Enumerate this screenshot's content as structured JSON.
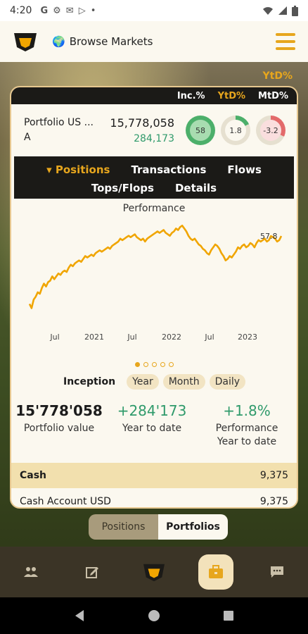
{
  "status_bar": {
    "time": "4:20",
    "icons": [
      "google-icon",
      "gear-icon",
      "gmail-icon",
      "play-icon",
      "dot"
    ],
    "right_icons": [
      "wifi-icon",
      "signal-icon",
      "battery-icon"
    ]
  },
  "app_bar": {
    "browse_label": "Browse Markets",
    "icons": [
      "app-logo",
      "globe-icon",
      "hamburger-menu-icon"
    ]
  },
  "range_indicator": "YtD%",
  "range_tabs": [
    "Inc.%",
    "YtD%",
    "MtD%"
  ],
  "portfolio": {
    "name_line1": "Portfolio US ...",
    "name_line2": "A",
    "value": "15,778,058",
    "change": "284,173",
    "rings": [
      {
        "label": "58",
        "color": "#4caf6a",
        "fill": 0.58
      },
      {
        "label": "1.8",
        "color": "#4caf6a",
        "fill": 0.18
      },
      {
        "label": "-3.2",
        "color": "#e36a6a",
        "fill": 0.32
      }
    ]
  },
  "tabs": {
    "positions": "Positions",
    "transactions": "Transactions",
    "flows": "Flows",
    "tops_flops": "Tops/Flops",
    "details": "Details"
  },
  "chart_data": {
    "type": "line",
    "title": "Performance",
    "x_tick_labels": [
      "Jul",
      "2021",
      "Jul",
      "2022",
      "Jul",
      "2023"
    ],
    "end_label": "57.8",
    "ylim": [
      0,
      70
    ],
    "color": "#f0a500",
    "y": [
      11,
      8,
      14,
      16,
      19,
      18,
      22,
      25,
      23,
      26,
      27,
      30,
      28,
      30,
      32,
      31,
      33,
      34,
      33,
      36,
      38,
      37,
      39,
      40,
      41,
      40,
      42,
      44,
      43,
      44,
      45,
      44,
      46,
      47,
      48,
      47,
      48,
      49,
      50,
      49,
      51,
      52,
      53,
      54,
      56,
      55,
      56,
      57,
      58,
      57,
      58,
      59,
      57,
      56,
      55,
      56,
      54,
      56,
      57,
      58,
      59,
      60,
      61,
      60,
      61,
      62,
      60,
      59,
      58,
      60,
      61,
      63,
      62,
      64,
      65,
      63,
      61,
      58,
      56,
      55,
      56,
      54,
      52,
      51,
      49,
      48,
      46,
      45,
      48,
      50,
      52,
      51,
      49,
      46,
      44,
      41,
      42,
      44,
      43,
      45,
      47,
      50,
      49,
      51,
      52,
      50,
      51,
      53,
      52,
      50,
      53,
      55,
      54,
      55,
      56,
      54,
      55,
      57.8,
      57,
      56,
      54,
      55,
      57.8
    ]
  },
  "pager_dots": 5,
  "pager_active": 0,
  "periods": {
    "label": "Inception",
    "year": "Year",
    "month": "Month",
    "daily": "Daily"
  },
  "stats": {
    "value": "15'778'058",
    "value_label": "Portfolio value",
    "ytd": "+284'173",
    "ytd_label": "Year to date",
    "perf": "+1.8%",
    "perf_label1": "Performance",
    "perf_label2": "Year to date"
  },
  "cash": {
    "label": "Cash",
    "value": "9,375"
  },
  "cash_account": {
    "label": "Cash Account USD",
    "value": "9,375"
  },
  "toggle": {
    "positions": "Positions",
    "portfolios": "Portfolios"
  },
  "bottom_nav": [
    "people-icon",
    "edit-icon",
    "logo-icon",
    "briefcase-icon",
    "chat-icon"
  ]
}
